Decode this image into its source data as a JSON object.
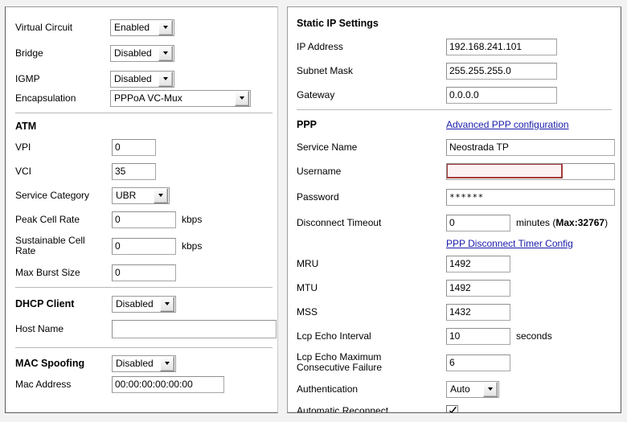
{
  "left_panel": {
    "top_section": [
      {
        "label": "Virtual Circuit",
        "control": "select",
        "value": "Enabled"
      },
      {
        "label": "Bridge",
        "control": "select",
        "value": "Disabled"
      },
      {
        "label": "IGMP",
        "control": "select",
        "value": "Disabled"
      },
      {
        "label": "Encapsulation",
        "control": "select",
        "value": "PPPoA VC-Mux"
      }
    ],
    "atm": {
      "heading": "ATM",
      "fields": [
        {
          "label": "VPI",
          "control": "text",
          "value": "0",
          "unit": ""
        },
        {
          "label": "VCI",
          "control": "text",
          "value": "35",
          "unit": ""
        },
        {
          "label": "Service Category",
          "control": "select",
          "value": "UBR",
          "unit": ""
        },
        {
          "label": "Peak Cell Rate",
          "control": "text",
          "value": "0",
          "unit": "kbps"
        },
        {
          "label": "Sustainable Cell\nRate",
          "control": "text",
          "value": "0",
          "unit": "kbps"
        },
        {
          "label": "Max Burst Size",
          "control": "text",
          "value": "0",
          "unit": ""
        }
      ]
    },
    "dhcp": {
      "heading": "DHCP Client",
      "heading_value": "Disabled",
      "host_name_label": "Host Name",
      "host_name_value": "",
      "host_name_placeholder": ""
    },
    "mac": {
      "heading": "MAC Spoofing",
      "heading_value": "Disabled",
      "mac_address_label": "Mac Address",
      "mac_address_value": "00:00:00:00:00:00"
    }
  },
  "right_panel": {
    "static_ip": {
      "heading": "Static IP Settings",
      "fields": [
        {
          "label": "IP Address",
          "value": "192.168.241.101"
        },
        {
          "label": "Subnet Mask",
          "value": "255.255.255.0"
        },
        {
          "label": "Gateway",
          "value": "0.0.0.0"
        }
      ]
    },
    "ppp": {
      "heading": "PPP",
      "advanced_link": "Advanced PPP configuration",
      "disconnect_timer_link": "PPP Disconnect Timer Config",
      "service_name_label": "Service Name",
      "service_name_value": "Neostrada TP",
      "username_label": "Username",
      "username_value": "",
      "password_label": "Password",
      "password_value": "******",
      "disconnect_timeout_label": "Disconnect Timeout",
      "disconnect_timeout_value": "0",
      "disconnect_timeout_unit": "minutes",
      "disconnect_timeout_max_prefix": "(",
      "disconnect_timeout_max": "Max:32767",
      "disconnect_timeout_max_suffix": ")",
      "mru_label": "MRU",
      "mru_value": "1492",
      "mtu_label": "MTU",
      "mtu_value": "1492",
      "mss_label": "MSS",
      "mss_value": "1432",
      "lcp_echo_interval_label": "Lcp Echo Interval",
      "lcp_echo_interval_value": "10",
      "lcp_echo_interval_unit": "seconds",
      "lcp_echo_max_label": "Lcp Echo Maximum\nConsecutive Failure",
      "lcp_echo_max_value": "6",
      "authentication_label": "Authentication",
      "authentication_value": "Auto",
      "automatic_reconnect_label": "Automatic Reconnect",
      "automatic_reconnect_checked": true
    }
  },
  "colors": {
    "panel_bg": "#ffffff",
    "page_bg": "#f2f2f2",
    "link": "#1a1aaa",
    "error_border": "#a33a3a",
    "separator": "#b8b8b8"
  }
}
